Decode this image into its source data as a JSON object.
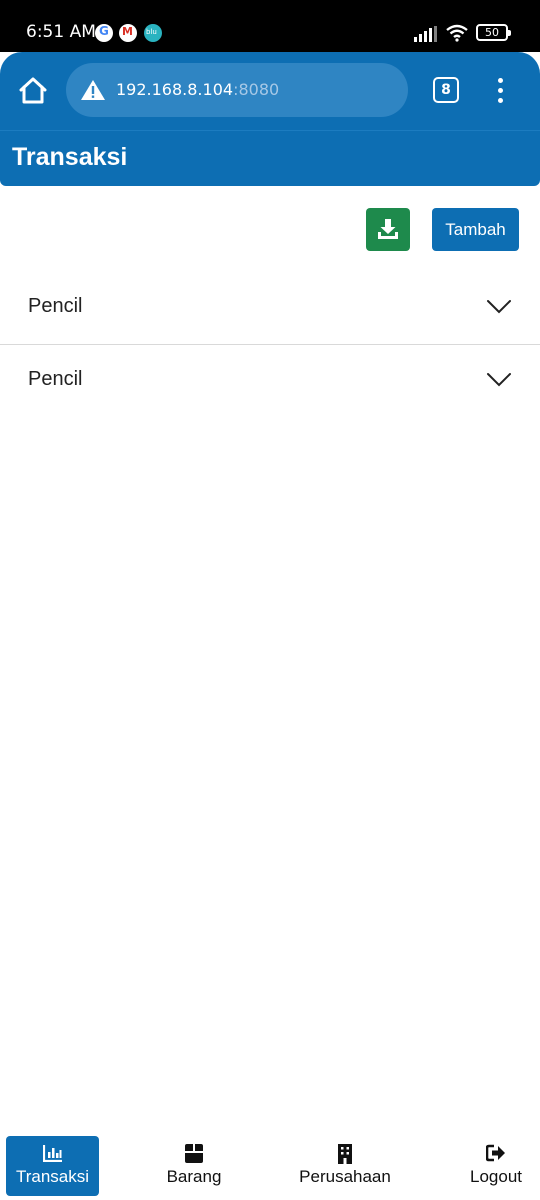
{
  "status_bar": {
    "time": "6:51 AM",
    "battery": "50",
    "notification_icons": [
      "google-icon",
      "gmail-icon",
      "blu-icon"
    ]
  },
  "browser": {
    "url_host": "192.168.8.104",
    "url_port": ":8080",
    "tab_count": "8"
  },
  "header": {
    "title": "Transaksi"
  },
  "toolbar": {
    "download_icon": "download-icon",
    "add_label": "Tambah"
  },
  "list": {
    "items": [
      {
        "label": "Pencil"
      },
      {
        "label": "Pencil"
      }
    ]
  },
  "bottom_nav": {
    "items": [
      {
        "label": "Transaksi",
        "icon": "bar-chart-icon",
        "active": true
      },
      {
        "label": "Barang",
        "icon": "box-icon",
        "active": false
      },
      {
        "label": "Perusahaan",
        "icon": "building-icon",
        "active": false
      },
      {
        "label": "Logout",
        "icon": "logout-icon",
        "active": false
      }
    ]
  },
  "colors": {
    "primary": "#0d6eb3",
    "success": "#1e8a4c",
    "status_bar": "#000000"
  }
}
